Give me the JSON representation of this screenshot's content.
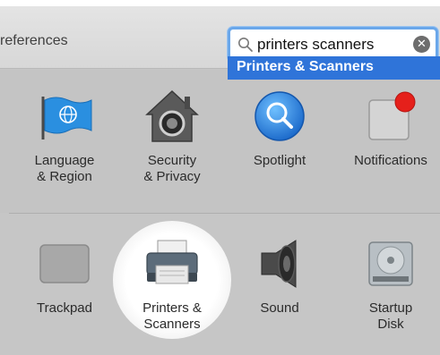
{
  "window": {
    "title": "references"
  },
  "search": {
    "value": "printers scanners",
    "placeholder": "Search"
  },
  "suggestion": {
    "label": "Printers & Scanners"
  },
  "row1": [
    {
      "label_line1": "Language",
      "label_line2": "& Region",
      "icon": "flag-globe-icon"
    },
    {
      "label_line1": "Security",
      "label_line2": "& Privacy",
      "icon": "house-lock-icon"
    },
    {
      "label_line1": "Spotlight",
      "label_line2": "",
      "icon": "magnifier-icon"
    },
    {
      "label_line1": "Notifications",
      "label_line2": "",
      "icon": "notifications-icon"
    }
  ],
  "row2": [
    {
      "label_line1": "Trackpad",
      "label_line2": "",
      "icon": "trackpad-icon"
    },
    {
      "label_line1": "Printers &",
      "label_line2": "Scanners",
      "icon": "printer-icon"
    },
    {
      "label_line1": "Sound",
      "label_line2": "",
      "icon": "speaker-icon"
    },
    {
      "label_line1": "Startup",
      "label_line2": "Disk",
      "icon": "hard-disk-icon"
    }
  ],
  "colors": {
    "accent": "#2f74d9",
    "focus_ring": "#6aa7ea",
    "badge_red": "#e5201b"
  }
}
